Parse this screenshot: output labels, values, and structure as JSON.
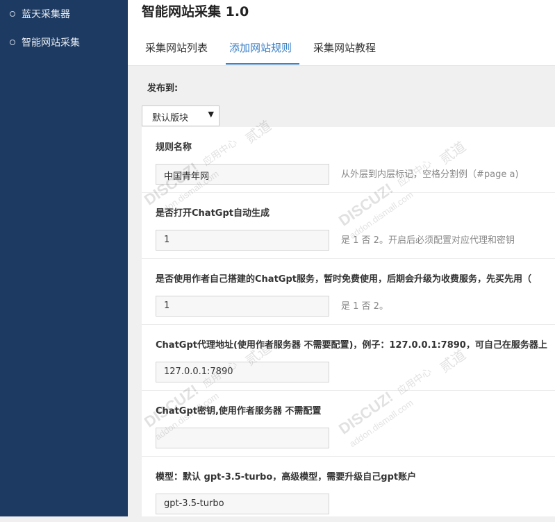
{
  "sidebar": {
    "items": [
      {
        "label": "蓝天采集器"
      },
      {
        "label": "智能网站采集"
      }
    ]
  },
  "header": {
    "title": "智能网站采集 1.0",
    "tabs": [
      {
        "label": "采集网站列表",
        "active": false
      },
      {
        "label": "添加网站规则",
        "active": true
      },
      {
        "label": "采集网站教程",
        "active": false
      }
    ]
  },
  "publish": {
    "label": "发布到:",
    "selected": "默认版块"
  },
  "fields": [
    {
      "label": "规则名称",
      "value": "中国青年网",
      "hint": "从外层到内层标记，空格分割例（#page a)"
    },
    {
      "label": "是否打开ChatGpt自动生成",
      "value": "1",
      "hint": "是 1 否 2。开启后必须配置对应代理和密钥"
    },
    {
      "label": "是否使用作者自己搭建的ChatGpt服务，暂时免费使用，后期会升级为收费服务，先买先用（",
      "value": "1",
      "hint": "是 1 否 2。"
    },
    {
      "label": "ChatGpt代理地址(使用作者服务器 不需要配置)，例子：127.0.0.1:7890，可自己在服务器上",
      "value": "127.0.0.1:7890",
      "hint": ""
    },
    {
      "label": "ChatGpt密钥,使用作者服务器 不需配置",
      "value": "",
      "hint": ""
    },
    {
      "label": "模型：默认 gpt-3.5-turbo，高级模型，需要升级自己gpt账户",
      "value": "gpt-3.5-turbo",
      "hint": ""
    }
  ],
  "watermark": {
    "brand": "DISCUZ!",
    "cn": "应用中心",
    "domain": "addon.dismall.com",
    "tag": "贰道"
  },
  "colors": {
    "sidebar_bg": "#1d3a62",
    "accent": "#3a7fc6"
  }
}
